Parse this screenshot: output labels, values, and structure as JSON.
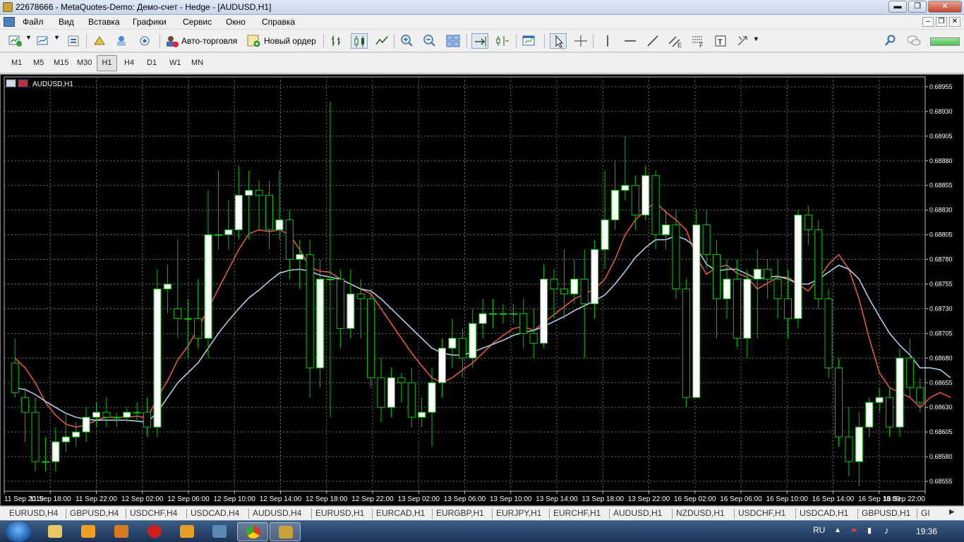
{
  "window": {
    "title": "22678666 - MetaQuotes-Demo: Демо-счет - Hedge - [AUDUSD,H1]"
  },
  "menu": [
    "Файл",
    "Вид",
    "Вставка",
    "Графики",
    "Сервис",
    "Окно",
    "Справка"
  ],
  "toolbar": {
    "autotrade_label": "Авто-торговля",
    "new_order_label": "Новый ордер"
  },
  "timeframes": [
    "M1",
    "M5",
    "M15",
    "M30",
    "H1",
    "H4",
    "D1",
    "W1",
    "MN"
  ],
  "active_timeframe": "H1",
  "chart_label": "AUDUSD,H1",
  "chart_data": {
    "type": "candlestick",
    "symbol": "AUDUSD",
    "timeframe": "H1",
    "y_ticks": [
      "0.68955",
      "0.68930",
      "0.68905",
      "0.68880",
      "0.68855",
      "0.68830",
      "0.68805",
      "0.68780",
      "0.68755",
      "0.68730",
      "0.68705",
      "0.68680",
      "0.68655",
      "0.68630",
      "0.68605",
      "0.68580",
      "0.68555"
    ],
    "x_ticks": [
      "11 Sep 2019",
      "11 Sep 18:00",
      "11 Sep 22:00",
      "12 Sep 02:00",
      "12 Sep 06:00",
      "12 Sep 10:00",
      "12 Sep 14:00",
      "12 Sep 18:00",
      "12 Sep 22:00",
      "13 Sep 02:00",
      "13 Sep 06:00",
      "13 Sep 10:00",
      "13 Sep 14:00",
      "13 Sep 18:00",
      "13 Sep 22:00",
      "16 Sep 02:00",
      "16 Sep 06:00",
      "16 Sep 10:00",
      "16 Sep 14:00",
      "16 Sep 18:00",
      "16 Sep 22:00"
    ],
    "ylim": [
      0.68545,
      0.68965
    ],
    "grid": true,
    "bull_color": "#ffffff",
    "bear_color": "#000000",
    "wick_color": "#00c800",
    "candles": [
      [
        0.68675,
        0.68645,
        0.687,
        0.6864
      ],
      [
        0.6864,
        0.68625,
        0.6865,
        0.68595
      ],
      [
        0.68625,
        0.68575,
        0.6864,
        0.68565
      ],
      [
        0.68575,
        0.68575,
        0.686,
        0.68565
      ],
      [
        0.68575,
        0.68595,
        0.6861,
        0.68565
      ],
      [
        0.68595,
        0.686,
        0.68625,
        0.68585
      ],
      [
        0.686,
        0.68605,
        0.68615,
        0.6859
      ],
      [
        0.68605,
        0.6862,
        0.6863,
        0.68595
      ],
      [
        0.6862,
        0.68625,
        0.68635,
        0.6861
      ],
      [
        0.68625,
        0.6862,
        0.6864,
        0.6861
      ],
      [
        0.6862,
        0.6862,
        0.68625,
        0.6861
      ],
      [
        0.6862,
        0.68625,
        0.6863,
        0.68615
      ],
      [
        0.68625,
        0.68625,
        0.68635,
        0.68615
      ],
      [
        0.68625,
        0.6861,
        0.6864,
        0.686
      ],
      [
        0.6861,
        0.6875,
        0.6877,
        0.686
      ],
      [
        0.6875,
        0.68755,
        0.68775,
        0.68725
      ],
      [
        0.6873,
        0.6872,
        0.688,
        0.687
      ],
      [
        0.6872,
        0.6872,
        0.6874,
        0.6868
      ],
      [
        0.6872,
        0.687,
        0.6876,
        0.6869
      ],
      [
        0.687,
        0.68805,
        0.6885,
        0.6868
      ],
      [
        0.68805,
        0.68805,
        0.6887,
        0.6879
      ],
      [
        0.68805,
        0.6881,
        0.6884,
        0.6879
      ],
      [
        0.6881,
        0.68845,
        0.68875,
        0.688
      ],
      [
        0.68845,
        0.6885,
        0.6887,
        0.688
      ],
      [
        0.6885,
        0.68845,
        0.6886,
        0.6881
      ],
      [
        0.68845,
        0.6881,
        0.6886,
        0.6879
      ],
      [
        0.6881,
        0.6882,
        0.6887,
        0.688
      ],
      [
        0.6882,
        0.6878,
        0.6883,
        0.6876
      ],
      [
        0.6878,
        0.68785,
        0.688,
        0.6875
      ],
      [
        0.68785,
        0.6867,
        0.688,
        0.6864
      ],
      [
        0.6867,
        0.6876,
        0.6878,
        0.6865
      ],
      [
        0.6876,
        0.6876,
        0.6894,
        0.6862
      ],
      [
        0.6876,
        0.6871,
        0.6877,
        0.6869
      ],
      [
        0.6871,
        0.68745,
        0.6877,
        0.687
      ],
      [
        0.68745,
        0.6874,
        0.6876,
        0.687
      ],
      [
        0.6874,
        0.6866,
        0.6875,
        0.6865
      ],
      [
        0.6866,
        0.6863,
        0.6868,
        0.68615
      ],
      [
        0.6863,
        0.6866,
        0.6867,
        0.6862
      ],
      [
        0.6866,
        0.68655,
        0.68665,
        0.68635
      ],
      [
        0.68655,
        0.6862,
        0.6867,
        0.6861
      ],
      [
        0.6862,
        0.68625,
        0.6864,
        0.6861
      ],
      [
        0.68625,
        0.68655,
        0.6867,
        0.6859
      ],
      [
        0.68655,
        0.6869,
        0.687,
        0.6864
      ],
      [
        0.6869,
        0.687,
        0.6872,
        0.6867
      ],
      [
        0.687,
        0.6868,
        0.6871,
        0.6866
      ],
      [
        0.6868,
        0.68715,
        0.6873,
        0.6867
      ],
      [
        0.68715,
        0.68725,
        0.6874,
        0.687
      ],
      [
        0.68725,
        0.68725,
        0.6874,
        0.6871
      ],
      [
        0.68725,
        0.68725,
        0.68735,
        0.68715
      ],
      [
        0.68725,
        0.68725,
        0.68735,
        0.68715
      ],
      [
        0.68725,
        0.68705,
        0.6874,
        0.6869
      ],
      [
        0.68705,
        0.68695,
        0.6873,
        0.6868
      ],
      [
        0.68695,
        0.6876,
        0.68775,
        0.6869
      ],
      [
        0.6876,
        0.6875,
        0.6877,
        0.6872
      ],
      [
        0.6875,
        0.68745,
        0.6879,
        0.6872
      ],
      [
        0.68745,
        0.6876,
        0.6878,
        0.68735
      ],
      [
        0.6876,
        0.68735,
        0.6879,
        0.6868
      ],
      [
        0.68735,
        0.6879,
        0.688,
        0.6872
      ],
      [
        0.6879,
        0.6882,
        0.6887,
        0.6877
      ],
      [
        0.6882,
        0.6885,
        0.6888,
        0.6881
      ],
      [
        0.6885,
        0.68855,
        0.68905,
        0.6884
      ],
      [
        0.68855,
        0.68825,
        0.68865,
        0.6881
      ],
      [
        0.68825,
        0.68865,
        0.68875,
        0.6882
      ],
      [
        0.68865,
        0.68805,
        0.6887,
        0.6879
      ],
      [
        0.68805,
        0.68815,
        0.6883,
        0.6879
      ],
      [
        0.68815,
        0.6875,
        0.6883,
        0.6874
      ],
      [
        0.6875,
        0.6864,
        0.6876,
        0.6863
      ],
      [
        0.6864,
        0.68815,
        0.6883,
        0.6864
      ],
      [
        0.68815,
        0.68785,
        0.6883,
        0.6877
      ],
      [
        0.68785,
        0.6874,
        0.688,
        0.687
      ],
      [
        0.6874,
        0.6876,
        0.6878,
        0.6872
      ],
      [
        0.6876,
        0.687,
        0.6878,
        0.6869
      ],
      [
        0.687,
        0.6876,
        0.6877,
        0.6868
      ],
      [
        0.6876,
        0.6877,
        0.6879,
        0.687
      ],
      [
        0.6877,
        0.6876,
        0.6878,
        0.6874
      ],
      [
        0.6876,
        0.6874,
        0.6878,
        0.6872
      ],
      [
        0.6874,
        0.6872,
        0.6877,
        0.687
      ],
      [
        0.6872,
        0.68825,
        0.6883,
        0.6871
      ],
      [
        0.68825,
        0.6881,
        0.68835,
        0.68795
      ],
      [
        0.6881,
        0.6874,
        0.6882,
        0.6873
      ],
      [
        0.6874,
        0.6867,
        0.6875,
        0.6866
      ],
      [
        0.6867,
        0.686,
        0.6868,
        0.6859
      ],
      [
        0.686,
        0.68575,
        0.6863,
        0.6856
      ],
      [
        0.68575,
        0.6861,
        0.68625,
        0.6855
      ],
      [
        0.6861,
        0.68635,
        0.6864,
        0.686
      ],
      [
        0.68635,
        0.6864,
        0.6865,
        0.68625
      ],
      [
        0.6864,
        0.6861,
        0.6865,
        0.686
      ],
      [
        0.6861,
        0.6868,
        0.6869,
        0.686
      ],
      [
        0.6868,
        0.6865,
        0.687,
        0.6864
      ],
      [
        0.6865,
        0.68635,
        0.6866,
        0.68625
      ]
    ],
    "series": [
      {
        "type": "line",
        "color": "#f05a46",
        "values": [
          0.6868,
          0.6867,
          0.68655,
          0.68635,
          0.68622,
          0.68613,
          0.6861,
          0.68612,
          0.68617,
          0.6862,
          0.6862,
          0.6862,
          0.68621,
          0.68619,
          0.6864,
          0.68657,
          0.68678,
          0.68692,
          0.6871,
          0.6873,
          0.6875,
          0.6877,
          0.6879,
          0.68806,
          0.6881,
          0.68808,
          0.6881,
          0.68805,
          0.6879,
          0.68772,
          0.68768,
          0.68767,
          0.6876,
          0.68755,
          0.6875,
          0.68745,
          0.6873,
          0.68715,
          0.687,
          0.68685,
          0.68672,
          0.6866,
          0.68655,
          0.6866,
          0.68668,
          0.68675,
          0.68685,
          0.68695,
          0.68703,
          0.6871,
          0.68712,
          0.68708,
          0.68716,
          0.68724,
          0.68732,
          0.6874,
          0.68745,
          0.6875,
          0.6876,
          0.6878,
          0.68805,
          0.6882,
          0.6883,
          0.68838,
          0.68828,
          0.6882,
          0.6881,
          0.68782,
          0.68765,
          0.68772,
          0.68774,
          0.68766,
          0.68762,
          0.6875,
          0.68756,
          0.68762,
          0.68762,
          0.68755,
          0.68748,
          0.6876,
          0.68775,
          0.68785,
          0.6877,
          0.6874,
          0.687,
          0.68665,
          0.6865,
          0.68645,
          0.6864,
          0.6863,
          0.6864,
          0.68645,
          0.6864
        ]
      },
      {
        "type": "line",
        "color": "#b4d7f0",
        "values": [
          0.6865,
          0.68648,
          0.68643,
          0.68636,
          0.6863,
          0.68624,
          0.6862,
          0.68618,
          0.68617,
          0.68617,
          0.68617,
          0.68617,
          0.68616,
          0.68615,
          0.68625,
          0.6864,
          0.68655,
          0.68665,
          0.68675,
          0.6869,
          0.68705,
          0.68718,
          0.6873,
          0.68741,
          0.68749,
          0.68758,
          0.68766,
          0.68769,
          0.6877,
          0.68768,
          0.68764,
          0.68762,
          0.6876,
          0.68755,
          0.6875,
          0.68748,
          0.6874,
          0.6873,
          0.6872,
          0.6871,
          0.687,
          0.6869,
          0.68685,
          0.68683,
          0.68683,
          0.68686,
          0.6869,
          0.68694,
          0.68698,
          0.68703,
          0.68706,
          0.68708,
          0.68712,
          0.68717,
          0.68722,
          0.68728,
          0.68733,
          0.68738,
          0.68744,
          0.68755,
          0.68768,
          0.68782,
          0.68792,
          0.688,
          0.688,
          0.68804,
          0.688,
          0.68792,
          0.68775,
          0.68768,
          0.6877,
          0.6877,
          0.68765,
          0.6876,
          0.68762,
          0.68763,
          0.6876,
          0.68755,
          0.68755,
          0.6876,
          0.68767,
          0.68774,
          0.6877,
          0.6876,
          0.6874,
          0.68722,
          0.68705,
          0.68693,
          0.68683,
          0.6867,
          0.6867,
          0.68668,
          0.6866
        ]
      }
    ]
  },
  "bottom_tabs": [
    "EURUSD,H4",
    "GBPUSD,H4",
    "USDCHF,H4",
    "USDCAD,H4",
    "AUDUSD,H4",
    "EURUSD,H1",
    "EURCAD,H1",
    "EURGBP,H1",
    "EURJPY,H1",
    "EURCHF,H1",
    "AUDUSD,H1",
    "NZDUSD,H1",
    "USDCHF,H1",
    "USDCAD,H1",
    "GBPUSD,H1",
    "GI"
  ],
  "taskbar": {
    "lang": "RU",
    "time": "19:36"
  }
}
